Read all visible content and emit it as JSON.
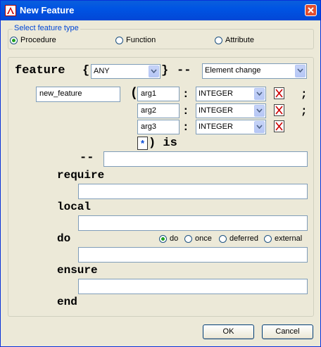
{
  "window": {
    "title": "New Feature"
  },
  "feature_type": {
    "legend": "Select feature type",
    "options": [
      {
        "label": "Procedure",
        "checked": true
      },
      {
        "label": "Function",
        "checked": false
      },
      {
        "label": "Attribute",
        "checked": false
      }
    ]
  },
  "signature": {
    "feature_kw": "feature",
    "open_brace": "{",
    "close_brace": "}",
    "dashes": "--",
    "export": "ANY",
    "category": "Element change",
    "name": "new_feature",
    "open_paren": "(",
    "close_paren_is": ") is",
    "args": [
      {
        "name": "arg1",
        "colon": ":",
        "type": "INTEGER",
        "sep": ";"
      },
      {
        "name": "arg2",
        "colon": ":",
        "type": "INTEGER",
        "sep": ";"
      },
      {
        "name": "arg3",
        "colon": ":",
        "type": "INTEGER",
        "sep": ""
      }
    ],
    "add_arg": "*"
  },
  "body": {
    "comment_kw": "--",
    "require_kw": "require",
    "local_kw": "local",
    "do_kw": "do",
    "ensure_kw": "ensure",
    "end_kw": "end",
    "comment": "",
    "require": "",
    "local": "",
    "do": "",
    "ensure": "",
    "do_options": [
      {
        "label": "do",
        "checked": true
      },
      {
        "label": "once",
        "checked": false
      },
      {
        "label": "deferred",
        "checked": false
      },
      {
        "label": "external",
        "checked": false
      }
    ]
  },
  "buttons": {
    "ok": "OK",
    "cancel": "Cancel"
  }
}
